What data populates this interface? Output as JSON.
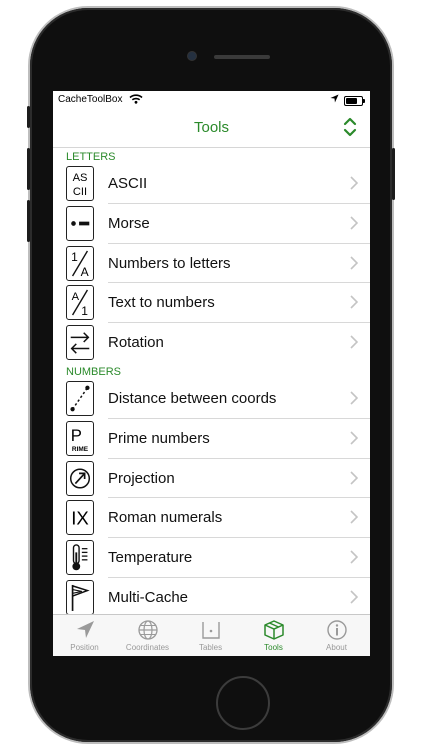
{
  "status": {
    "carrier": "CacheToolBox"
  },
  "navbar": {
    "title": "Tools"
  },
  "sections": [
    {
      "header": "LETTERS",
      "rows": [
        {
          "label": "ASCII",
          "icon": "ascii-icon"
        },
        {
          "label": "Morse",
          "icon": "morse-icon"
        },
        {
          "label": "Numbers to letters",
          "icon": "numbers-to-letters-icon"
        },
        {
          "label": "Text to numbers",
          "icon": "text-to-numbers-icon"
        },
        {
          "label": "Rotation",
          "icon": "rotation-icon"
        }
      ]
    },
    {
      "header": "NUMBERS",
      "rows": [
        {
          "label": "Distance between coords",
          "icon": "distance-icon"
        },
        {
          "label": "Prime numbers",
          "icon": "prime-icon"
        },
        {
          "label": "Projection",
          "icon": "projection-icon"
        },
        {
          "label": "Roman numerals",
          "icon": "roman-icon"
        },
        {
          "label": "Temperature",
          "icon": "thermometer-icon"
        },
        {
          "label": "Multi-Cache",
          "icon": "flag-icon"
        }
      ]
    }
  ],
  "icon_text": {
    "ascii_top": "AS",
    "ascii_bottom": "CII",
    "prime": "P",
    "prime_small": "RIME",
    "roman": "IX"
  },
  "tabs": [
    {
      "label": "Position",
      "icon": "location-arrow-icon",
      "active": false
    },
    {
      "label": "Coordinates",
      "icon": "globe-icon",
      "active": false
    },
    {
      "label": "Tables",
      "icon": "table-icon",
      "active": false
    },
    {
      "label": "Tools",
      "icon": "box-icon",
      "active": true
    },
    {
      "label": "About",
      "icon": "info-icon",
      "active": false
    }
  ],
  "colors": {
    "accent": "#2b8a2b"
  }
}
